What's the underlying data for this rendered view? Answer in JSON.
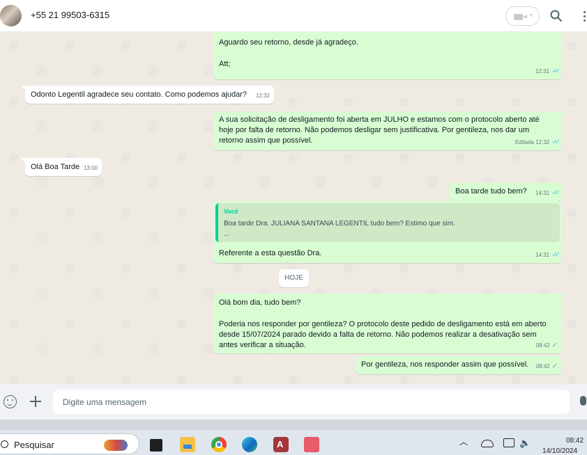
{
  "header": {
    "contact_name": "+55 21 99503-6315",
    "icons": [
      "avatar",
      "video-call-icon",
      "chevron-down-icon",
      "search-icon",
      "kebab-menu-icon"
    ]
  },
  "messages": [
    {
      "direction": "outgoing",
      "lines": [
        "Aguardo seu retorno, desde já agradeço.",
        "",
        "Att;"
      ],
      "time": "12:31",
      "status": "read"
    },
    {
      "direction": "incoming",
      "lines": [
        "Odonto Legentil agradece seu contato. Como podemos ajudar?"
      ],
      "time": "12:32"
    },
    {
      "direction": "outgoing",
      "lines": [
        "A sua solicitação de desligamento foi aberta em JULHO e estamos com o protocolo aberto até",
        "hoje por falta de retorno. Não podemos desligar sem justificativa. Por gentileza, nos dar um",
        "retorno assim que possível."
      ],
      "edited_label": "Editada",
      "time": "12:32",
      "status": "read"
    },
    {
      "direction": "incoming",
      "lines": [
        "Olá Boa Tarde"
      ],
      "time": "13:00"
    },
    {
      "direction": "outgoing",
      "lines": [
        "Boa tarde tudo bem?"
      ],
      "time": "14:31",
      "status": "read"
    },
    {
      "direction": "outgoing",
      "quote": {
        "author": "Você",
        "line1": "Boa tarde Dra. JULIANA SANTANA LEGENTIL tudo bem? Estimo que sim.",
        "line2": "..."
      },
      "lines": [
        "Referente a esta questão Dra."
      ],
      "time": "14:31",
      "status": "read"
    },
    {
      "direction": "outgoing",
      "lines": [
        "Olá bom dia, tudo bem?",
        "",
        "Poderia nos responder por gentileza? O protocolo deste pedido de desligamento está em aberto",
        "desde 15/07/2024  parado devido a falta de retorno. Não podemos realizar a desativação sem",
        "antes verificar a situação."
      ],
      "time": "08:42",
      "status": "sent"
    },
    {
      "direction": "outgoing",
      "lines": [
        "Por gentileza, nos responder assim que possível."
      ],
      "time": "08:42",
      "status": "sent"
    }
  ],
  "day_separator": "HOJE",
  "composer": {
    "placeholder": "Digite uma mensagem",
    "icons": [
      "emoji-icon",
      "plus-icon",
      "microphone-icon"
    ]
  },
  "taskbar": {
    "search_label": "Pesquisar",
    "time": "08:42",
    "date": "14/10/2024",
    "apps": [
      "task-view",
      "file-explorer",
      "chrome",
      "edge",
      "access",
      "snipping-tool"
    ]
  },
  "colors": {
    "outgoing_bubble": "#d9fdd3",
    "incoming_bubble": "#ffffff",
    "chat_background": "#efeae2",
    "read_ticks": "#53bdeb",
    "quote_accent": "#06cf9c"
  }
}
